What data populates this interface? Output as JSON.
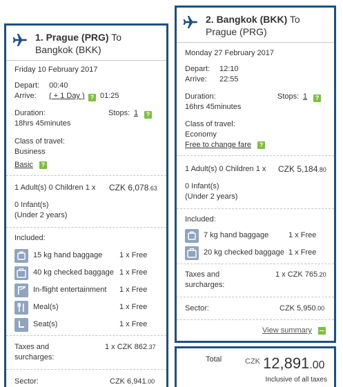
{
  "flight1": {
    "title_bold": "1. Prague (PRG)",
    "title_rest": " To",
    "title_line2": "Bangkok (BKK)",
    "date": "Friday 10 February 2017",
    "depart_label": "Depart:",
    "depart_time": "00:40",
    "arrive_label": "Arrive:",
    "plus_day": "( + 1 Day )",
    "arrive_time": "01:25",
    "duration_label": "Duration:",
    "duration_value": "18hrs 45minutes",
    "stops_label": "Stops:",
    "stops_value": "1",
    "class_label": "Class of travel:",
    "class_value": "Business",
    "fare_link": "Basic",
    "passengers": "1 Adult(s)  0 Children  1 x",
    "price_main": "CZK 6,078",
    "price_dec": ".63",
    "infants": "0 Infant(s)",
    "infants_note": "(Under 2 years)",
    "included_label": "Included:",
    "included": [
      {
        "icon": "hand-baggage-icon",
        "label": "15 kg hand baggage",
        "qty": "1 x Free"
      },
      {
        "icon": "checked-baggage-icon",
        "label": "40 kg checked baggage",
        "qty": "1 x Free"
      },
      {
        "icon": "entertainment-icon",
        "label": "In-flight entertainment",
        "qty": "1 x Free"
      },
      {
        "icon": "meal-icon",
        "label": "Meal(s)",
        "qty": "1 x Free"
      },
      {
        "icon": "seat-icon",
        "label": "Seat(s)",
        "qty": "1 x Free"
      }
    ],
    "taxes_label_1": "Taxes and",
    "taxes_label_2": "surcharges:",
    "taxes_value": "1 x CZK 862",
    "taxes_dec": ".37",
    "sector_label": "Sector:",
    "sector_value": "CZK 6,941",
    "sector_dec": ".00"
  },
  "flight2": {
    "title_bold": "2. Bangkok (BKK)",
    "title_rest": " To",
    "title_line2": "Prague (PRG)",
    "date": "Monday 27 February 2017",
    "depart_label": "Depart:",
    "depart_time": "12:10",
    "arrive_label": "Arrive:",
    "arrive_time": "22:55",
    "duration_label": "Duration:",
    "duration_value": "16hrs 45minutes",
    "stops_label": "Stops:",
    "stops_value": "1",
    "class_label": "Class of travel:",
    "class_value": "Economy",
    "fare_link": "Free to change fare",
    "passengers": "1 Adult(s)  0 Children  1 x",
    "price_main": "CZK 5,184",
    "price_dec": ".80",
    "infants": "0 Infant(s)",
    "infants_note": "(Under 2 years)",
    "included_label": "Included:",
    "included": [
      {
        "icon": "hand-baggage-icon",
        "label": "7 kg hand baggage",
        "qty": "1 x Free"
      },
      {
        "icon": "checked-baggage-icon",
        "label": "20 kg checked baggage",
        "qty": "1 x Free"
      }
    ],
    "taxes_label_1": "Taxes and",
    "taxes_label_2": "surcharges:",
    "taxes_value": "1 x CZK 765",
    "taxes_dec": ".20",
    "sector_label": "Sector:",
    "sector_value": "CZK 5,950",
    "sector_dec": ".00",
    "view_summary": "View summary"
  },
  "total": {
    "label": "Total",
    "currency": "CZK",
    "amount": "12,891",
    "decimals": ".00",
    "note": "Inclusive of all taxes"
  },
  "help_badge": "?",
  "colors": {
    "border": "#1b4f86",
    "badge": "#7fbf3f",
    "icon_bg": "#8fa5bf"
  }
}
